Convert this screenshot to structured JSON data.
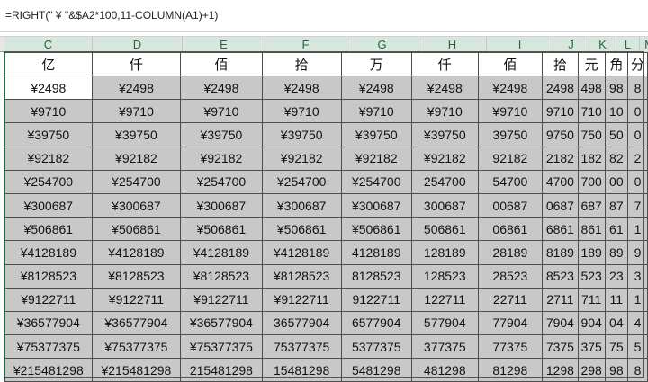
{
  "formula_bar": {
    "formula": "=RIGHT(\" ¥ \"&$A2*100,11-COLUMN(A1)+1)"
  },
  "columns": [
    "C",
    "D",
    "E",
    "F",
    "G",
    "H",
    "I",
    "J",
    "K",
    "L",
    "M"
  ],
  "header_row": [
    "亿",
    "仟",
    "佰",
    "拾",
    "万",
    "仟",
    "佰",
    "拾",
    "元",
    "角",
    "分"
  ],
  "rows": [
    [
      "¥2498",
      "¥2498",
      "¥2498",
      "¥2498",
      "¥2498",
      "¥2498",
      "¥2498",
      "2498",
      "498",
      "98",
      "8"
    ],
    [
      "¥9710",
      "¥9710",
      "¥9710",
      "¥9710",
      "¥9710",
      "¥9710",
      "¥9710",
      "9710",
      "710",
      "10",
      "0"
    ],
    [
      "¥39750",
      "¥39750",
      "¥39750",
      "¥39750",
      "¥39750",
      "¥39750",
      "39750",
      "9750",
      "750",
      "50",
      "0"
    ],
    [
      "¥92182",
      "¥92182",
      "¥92182",
      "¥92182",
      "¥92182",
      "¥92182",
      "92182",
      "2182",
      "182",
      "82",
      "2"
    ],
    [
      "¥254700",
      "¥254700",
      "¥254700",
      "¥254700",
      "¥254700",
      "254700",
      "54700",
      "4700",
      "700",
      "00",
      "0"
    ],
    [
      "¥300687",
      "¥300687",
      "¥300687",
      "¥300687",
      "¥300687",
      "300687",
      "00687",
      "0687",
      "687",
      "87",
      "7"
    ],
    [
      "¥506861",
      "¥506861",
      "¥506861",
      "¥506861",
      "¥506861",
      "506861",
      "06861",
      "6861",
      "861",
      "61",
      "1"
    ],
    [
      "¥4128189",
      "¥4128189",
      "¥4128189",
      "¥4128189",
      "4128189",
      "128189",
      "28189",
      "8189",
      "189",
      "89",
      "9"
    ],
    [
      "¥8128523",
      "¥8128523",
      "¥8128523",
      "¥8128523",
      "8128523",
      "128523",
      "28523",
      "8523",
      "523",
      "23",
      "3"
    ],
    [
      "¥9122711",
      "¥9122711",
      "¥9122711",
      "¥9122711",
      "9122711",
      "122711",
      "22711",
      "2711",
      "711",
      "11",
      "1"
    ],
    [
      "¥36577904",
      "¥36577904",
      "¥36577904",
      "36577904",
      "6577904",
      "577904",
      "77904",
      "7904",
      "904",
      "04",
      "4"
    ],
    [
      "¥75377375",
      "¥75377375",
      "¥75377375",
      "75377375",
      "5377375",
      "377375",
      "77375",
      "7375",
      "375",
      "75",
      "5"
    ],
    [
      "¥215481298",
      "¥215481298",
      "215481298",
      "15481298",
      "5481298",
      "481298",
      "81298",
      "1298",
      "298",
      "98",
      "8"
    ]
  ],
  "colors": {
    "selection_border": "#217346",
    "selected_fill": "#c8c8c8",
    "header_highlight": "#d8e7dd"
  }
}
